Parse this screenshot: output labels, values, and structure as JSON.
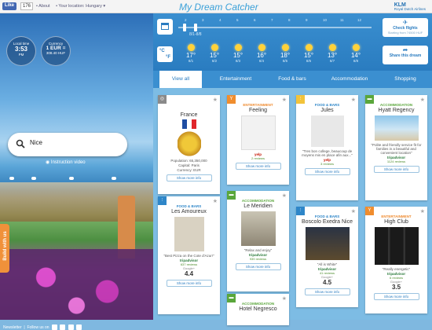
{
  "topbar": {
    "fb_like": "Like",
    "fb_count": "176",
    "links": [
      "• About",
      "• Your location: Hungary ▾"
    ],
    "brand": "My Dream Catcher",
    "klm": "KLM",
    "klm_sub": "Royal Dutch Airlines"
  },
  "hero": {
    "localtime_label": "Local time",
    "localtime_value": "3:53",
    "localtime_sub": "PM",
    "currency_label": "Currency",
    "currency_value": "1 EUR =",
    "currency_sub": "308.40 HUF",
    "search_value": "Nice",
    "search_placeholder": "Search destination",
    "intro_video": "Instruction video",
    "build_tab": "Build with us",
    "newsletter": "Newsletter",
    "follow": "Follow us on"
  },
  "weather": {
    "timeline_ticks": [
      "2",
      "3",
      "4",
      "5",
      "6",
      "7",
      "8",
      "9",
      "10",
      "11",
      "12"
    ],
    "timeline_label": "8/1-8/8",
    "unit_c": "°C",
    "unit_f": "°F",
    "days": [
      {
        "temp": "17°",
        "date": "8/1"
      },
      {
        "temp": "15°",
        "date": "8/2"
      },
      {
        "temp": "15°",
        "date": "8/3"
      },
      {
        "temp": "16°",
        "date": "8/4"
      },
      {
        "temp": "18°",
        "date": "8/5"
      },
      {
        "temp": "15°",
        "date": "8/6"
      },
      {
        "temp": "13°",
        "date": "8/7"
      },
      {
        "temp": "14°",
        "date": "8/8"
      }
    ],
    "check_flights": "Check flights",
    "check_flights_sub": "Starting from 74500 HUF",
    "share_dream": "Share this dream"
  },
  "tabs": [
    "View all",
    "Entertainment",
    "Food & bars",
    "Accommodation",
    "Shopping"
  ],
  "cards": [
    {
      "cat": "",
      "title": "France",
      "quote": "Population: 65,350,000",
      "meta": "Capital: Paris",
      "meta2": "Currency: EUR",
      "btn": "Show more info"
    },
    {
      "cat": "ENTERTAINMENT",
      "title": "Feeling",
      "quote": "",
      "meta": "yelp",
      "meta2": "2 reviews",
      "btn": "Show more info"
    },
    {
      "cat": "FOOD & BARS",
      "title": "Jules",
      "quote": "\"Tres bon college, beaucoup de moyens mis en place afin aux...\"",
      "meta": "yelp",
      "meta2": "3 reviews",
      "btn": "Show more info"
    },
    {
      "cat": "ACCOMMODATION",
      "title": "Hyatt Regency",
      "quote": "\"Polite and friendly service fit for families in a beautiful and convenient location\"",
      "meta": "tripadvisor",
      "meta2": "1124 reviews",
      "btn": "Show more info"
    },
    {
      "cat": "FOOD & BARS",
      "title": "Les Amoureux",
      "quote": "\"Best Pizza on the Cote d'Azur!\"",
      "meta": "tripadvisor",
      "meta2": "637 reviews",
      "score": "4.4",
      "score_label": "Google+",
      "btn": "Show more info"
    },
    {
      "cat": "ACCOMMODATION",
      "title": "Le Meridien",
      "quote": "\"Relax and enjoy\"",
      "meta": "tripadvisor",
      "meta2": "939 reviews",
      "btn": "Show more info"
    },
    {
      "cat": "FOOD & BARS",
      "title": "Boscolo Exedra Nice",
      "quote": "\"All is White\"",
      "meta": "tripadvisor",
      "meta2": "41 reviews",
      "score": "4.5",
      "score_label": "Google+",
      "btn": "Show more info"
    },
    {
      "cat": "ENTERTAINMENT",
      "title": "High Club",
      "quote": "\"Really energetic\"",
      "meta": "tripadvisor",
      "meta2": "6 reviews",
      "score": "3.5",
      "score_label": "Google+",
      "btn": "Show more info"
    },
    {
      "cat": "ACCOMMODATION",
      "title": "Hotel Negresco",
      "quote": "",
      "meta": "",
      "meta2": "",
      "btn": ""
    }
  ],
  "colors": {
    "entertainment": "#f08d2e",
    "food": "#2e86c8",
    "accommodation": "#5aa63b",
    "brand": "#3aa0d8"
  }
}
